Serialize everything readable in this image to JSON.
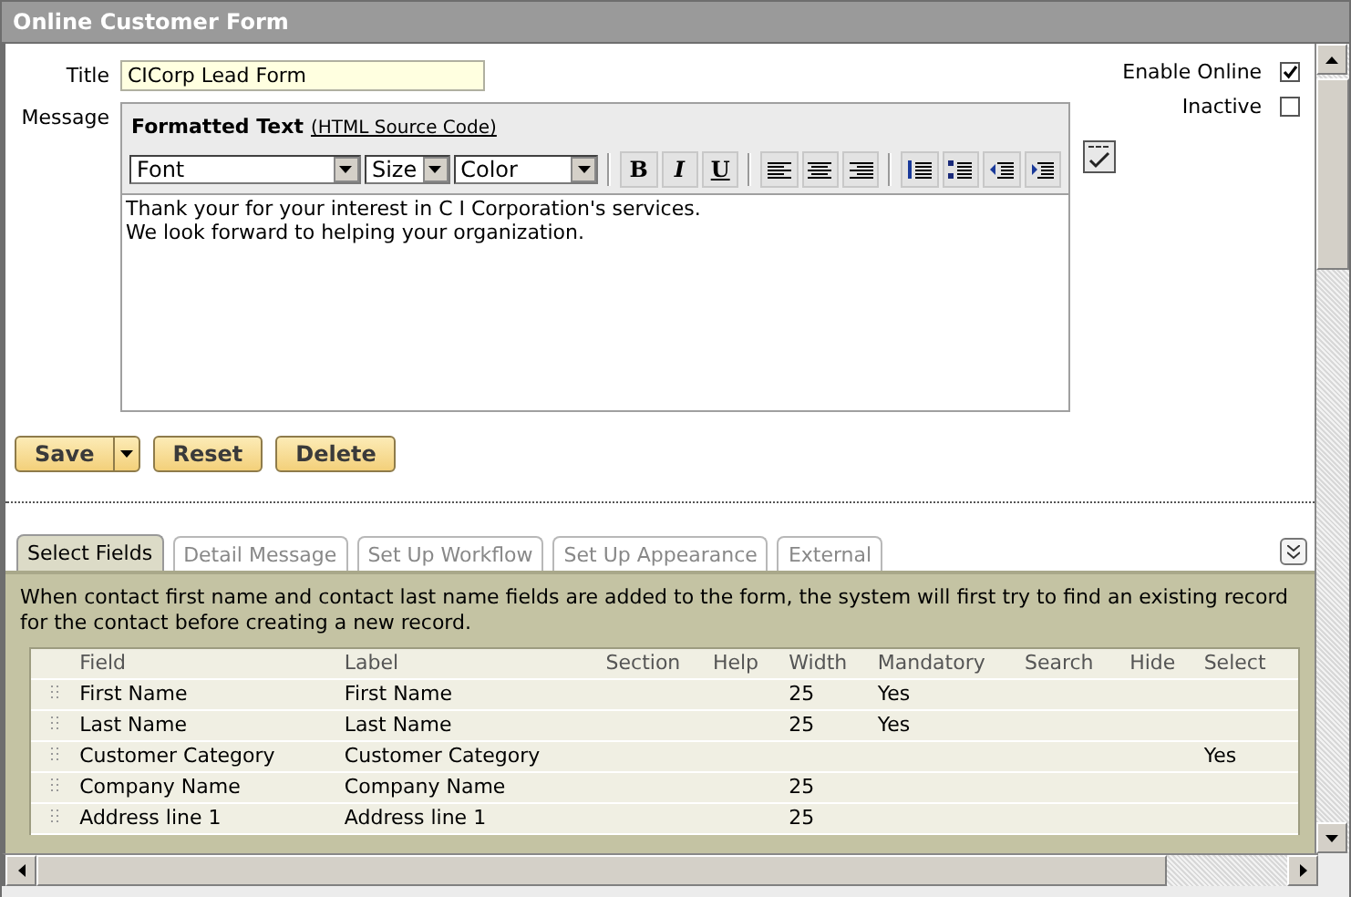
{
  "window": {
    "title": "Online Customer Form"
  },
  "form": {
    "title_label": "Title",
    "title_value": "CICorp Lead Form",
    "message_label": "Message"
  },
  "editor": {
    "heading": "Formatted Text",
    "source_link": "(HTML Source Code)",
    "font": "Font",
    "size": "Size",
    "color_label": "Color",
    "format_buttons": [
      {
        "kind": "bold",
        "label": "B"
      },
      {
        "kind": "italic",
        "label": "I"
      },
      {
        "kind": "underline",
        "label": "U"
      }
    ],
    "body": [
      "Thank your for your interest in C I Corporation's services.",
      "We look forward to helping your organization."
    ]
  },
  "options": [
    {
      "label": "Enable Online",
      "checked": true
    },
    {
      "label": "Inactive",
      "checked": false
    }
  ],
  "actions": [
    {
      "label": "Save",
      "kind": "split"
    },
    {
      "label": "Reset",
      "kind": "plain"
    },
    {
      "label": "Delete",
      "kind": "plain"
    }
  ],
  "tabs": [
    {
      "label": "Select Fields",
      "selected": true
    },
    {
      "label": "Detail Message",
      "selected": false
    },
    {
      "label": "Set Up Workflow",
      "selected": false
    },
    {
      "label": "Set Up Appearance",
      "selected": false
    },
    {
      "label": "External",
      "selected": false
    }
  ],
  "info": "When contact first name and contact last name fields are added to the form, the system will first try to find an existing record for the contact before creating a new record.",
  "table": {
    "columns": [
      "Field",
      "Label",
      "Section",
      "Help",
      "Width",
      "Mandatory",
      "Search",
      "Hide",
      "Select"
    ],
    "rows": [
      {
        "cells": [
          "First Name",
          "First Name",
          null,
          null,
          "25",
          "Yes",
          null,
          null,
          null
        ]
      },
      {
        "cells": [
          "Last Name",
          "Last Name",
          null,
          null,
          "25",
          "Yes",
          null,
          null,
          null
        ]
      },
      {
        "cells": [
          "Customer Category",
          "Customer Category",
          null,
          null,
          null,
          null,
          null,
          null,
          "Yes"
        ]
      },
      {
        "cells": [
          "Company Name",
          "Company Name",
          null,
          null,
          "25",
          null,
          null,
          null,
          null
        ]
      },
      {
        "cells": [
          "Address line 1",
          "Address line 1",
          null,
          null,
          "25",
          null,
          null,
          null,
          null
        ]
      }
    ]
  }
}
